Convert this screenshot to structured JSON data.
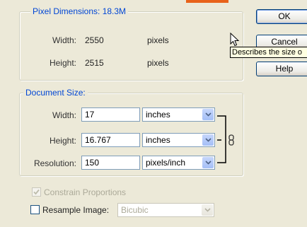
{
  "pixel_dimensions": {
    "legend": "Pixel Dimensions:  18.3M",
    "width_label": "Width:",
    "width_value": "2550",
    "width_unit": "pixels",
    "height_label": "Height:",
    "height_value": "2515",
    "height_unit": "pixels"
  },
  "document_size": {
    "legend": "Document Size:",
    "width_label": "Width:",
    "width_value": "17",
    "width_unit": "inches",
    "height_label": "Height:",
    "height_value": "16.767",
    "height_unit": "inches",
    "resolution_label": "Resolution:",
    "resolution_value": "150",
    "resolution_unit": "pixels/inch"
  },
  "options": {
    "constrain_label": "Constrain Proportions",
    "constrain_checked": true,
    "resample_label": "Resample Image:",
    "resample_checked": false,
    "resample_method": "Bicubic"
  },
  "buttons": {
    "ok": "OK",
    "cancel": "Cancel",
    "help": "Help"
  },
  "tooltip": "Describes the size o",
  "colors": {
    "dialog_bg": "#ece9d8",
    "legend_blue": "#0046d5",
    "tooltip_bg": "#ffffe1",
    "top_accent": "#e8621a"
  }
}
